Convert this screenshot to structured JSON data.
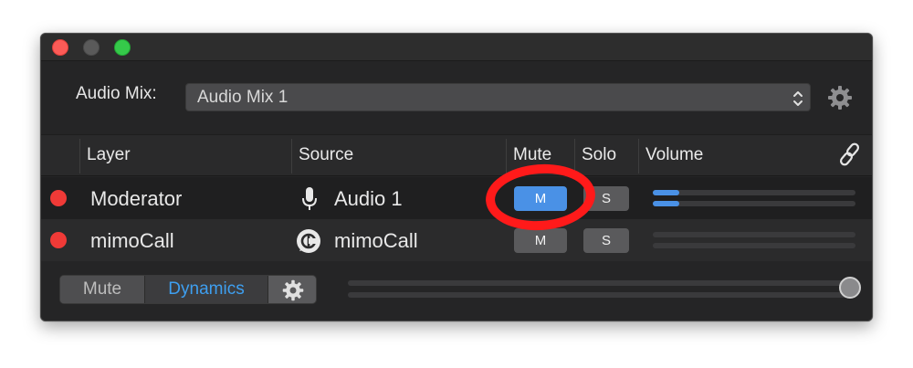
{
  "window": {
    "controls": [
      "close",
      "minimize",
      "zoom"
    ]
  },
  "audio_mix": {
    "label": "Audio Mix:",
    "selected": "Audio Mix 1",
    "settings_icon": "gear-icon"
  },
  "table": {
    "headers": {
      "layer": "Layer",
      "source": "Source",
      "mute": "Mute",
      "solo": "Solo",
      "volume": "Volume"
    },
    "link_icon": "link-icon",
    "rows": [
      {
        "status_color": "#f03a37",
        "layer": "Moderator",
        "source_icon": "microphone-icon",
        "source": "Audio 1",
        "mute_label": "M",
        "mute_active": true,
        "solo_label": "S",
        "volume_left": 0.13,
        "volume_right": 0.13
      },
      {
        "status_color": "#f03a37",
        "layer": "mimoCall",
        "source_icon": "mimocall-icon",
        "source": "mimoCall",
        "mute_label": "M",
        "mute_active": false,
        "solo_label": "S",
        "volume_left": 0,
        "volume_right": 0
      }
    ]
  },
  "footer": {
    "mute_tab": "Mute",
    "dynamics_tab": "Dynamics",
    "active_tab": "Dynamics",
    "settings_icon": "gear-icon",
    "master_volume": 1.0
  },
  "colors": {
    "accent": "#4a91e6",
    "status_red": "#f03a37",
    "annotation_red": "#ff1a1a"
  }
}
